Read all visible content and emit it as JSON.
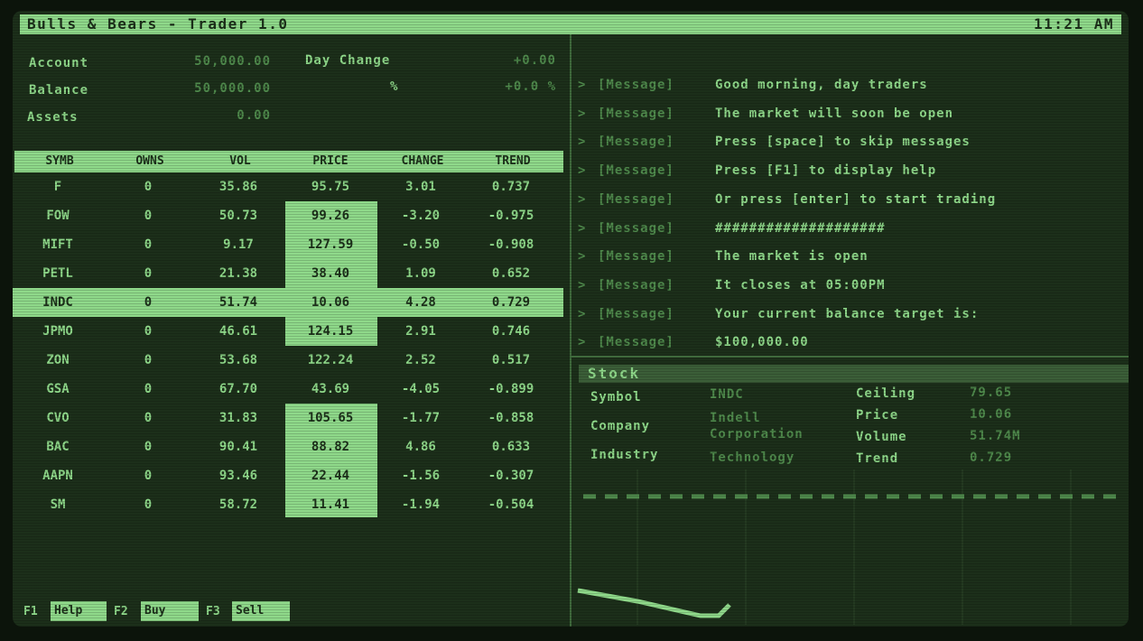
{
  "app": {
    "title": "Bulls & Bears - Trader 1.0",
    "clock": "11:21 AM"
  },
  "account": {
    "account_label": "Account",
    "account_value": "50,000.00",
    "balance_label": "Balance",
    "balance_value": "50,000.00",
    "assets_label": "Assets",
    "assets_value": "0.00",
    "day_change_label": "Day Change",
    "day_change_value": "+0.00",
    "pct_label": "%",
    "pct_value": "+0.0 %"
  },
  "table": {
    "headers": [
      "SYMB",
      "OWNS",
      "VOL",
      "PRICE",
      "CHANGE",
      "TREND"
    ],
    "rows": [
      {
        "symb": "F",
        "owns": "0",
        "vol": "35.86",
        "price": "95.75",
        "change": "3.01",
        "trend": "0.737"
      },
      {
        "symb": "FOW",
        "owns": "0",
        "vol": "50.73",
        "price": "99.26",
        "change": "-3.20",
        "trend": "-0.975"
      },
      {
        "symb": "MIFT",
        "owns": "0",
        "vol": "9.17",
        "price": "127.59",
        "change": "-0.50",
        "trend": "-0.908"
      },
      {
        "symb": "PETL",
        "owns": "0",
        "vol": "21.38",
        "price": "38.40",
        "change": "1.09",
        "trend": "0.652"
      },
      {
        "symb": "INDC",
        "owns": "0",
        "vol": "51.74",
        "price": "10.06",
        "change": "4.28",
        "trend": "0.729"
      },
      {
        "symb": "JPMO",
        "owns": "0",
        "vol": "46.61",
        "price": "124.15",
        "change": "2.91",
        "trend": "0.746"
      },
      {
        "symb": "ZON",
        "owns": "0",
        "vol": "53.68",
        "price": "122.24",
        "change": "2.52",
        "trend": "0.517"
      },
      {
        "symb": "GSA",
        "owns": "0",
        "vol": "67.70",
        "price": "43.69",
        "change": "-4.05",
        "trend": "-0.899"
      },
      {
        "symb": "CVO",
        "owns": "0",
        "vol": "31.83",
        "price": "105.65",
        "change": "-1.77",
        "trend": "-0.858"
      },
      {
        "symb": "BAC",
        "owns": "0",
        "vol": "90.41",
        "price": "88.82",
        "change": "4.86",
        "trend": "0.633"
      },
      {
        "symb": "AAPN",
        "owns": "0",
        "vol": "93.46",
        "price": "22.44",
        "change": "-1.56",
        "trend": "-0.307"
      },
      {
        "symb": "SM",
        "owns": "0",
        "vol": "58.72",
        "price": "11.41",
        "change": "-1.94",
        "trend": "-0.504"
      }
    ],
    "selected_symbol": "INDC"
  },
  "messages": [
    {
      "tag": "[Message]",
      "text": "Good morning, day traders"
    },
    {
      "tag": "[Message]",
      "text": "The market will soon be open"
    },
    {
      "tag": "[Message]",
      "text": "Press [space] to skip messages"
    },
    {
      "tag": "[Message]",
      "text": "Press [F1] to display help"
    },
    {
      "tag": "[Message]",
      "text": "Or press [enter] to start trading"
    },
    {
      "tag": "[Message]",
      "text": "####################"
    },
    {
      "tag": "[Message]",
      "text": "The market is open"
    },
    {
      "tag": "[Message]",
      "text": "It closes at 05:00PM"
    },
    {
      "tag": "[Message]",
      "text": "Your current balance target is:"
    },
    {
      "tag": "[Message]",
      "text": "$100,000.00"
    }
  ],
  "stock": {
    "header": "Stock",
    "symbol_label": "Symbol",
    "symbol": "INDC",
    "company_label": "Company",
    "company_line1": "Indell",
    "company_line2": "Corporation",
    "industry_label": "Industry",
    "industry": "Technology",
    "ceiling_label": "Ceiling",
    "ceiling": "79.65",
    "price_label": "Price",
    "price": "10.06",
    "volume_label": "Volume",
    "volume": "51.74M",
    "trend_label": "Trend",
    "trend": "0.729"
  },
  "fkeys": [
    {
      "key": "F1",
      "label": "Help"
    },
    {
      "key": "F2",
      "label": "Buy"
    },
    {
      "key": "F3",
      "label": "Sell"
    }
  ],
  "colors": {
    "screen_bg": "#1c2f1a",
    "phosphor": "#8fd98a",
    "dim": "#4f8a4c"
  }
}
